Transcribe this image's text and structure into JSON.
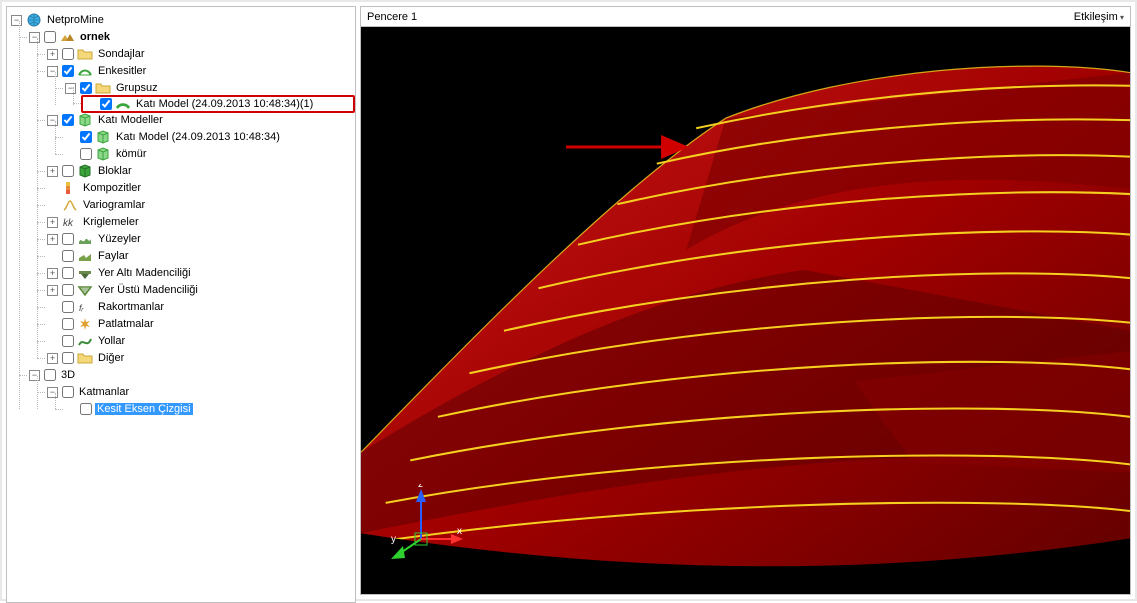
{
  "viewport": {
    "title": "Pencere 1",
    "interaction_label": "Etkileşim",
    "axis": {
      "x": "x",
      "y": "y",
      "z": "z"
    }
  },
  "tree": {
    "root": "NetproMine",
    "project": "ornek",
    "nodes": {
      "sondajlar": "Sondajlar",
      "enkesitler": "Enkesitler",
      "grupsuz": "Grupsuz",
      "katimodel_en": "Katı Model (24.09.2013 10:48:34)(1)",
      "katimodeller": "Katı Modeller",
      "katimodel": "Katı Model (24.09.2013 10:48:34)",
      "komur": "kömür",
      "bloklar": "Bloklar",
      "kompozitler": "Kompozitler",
      "variogramlar": "Variogramlar",
      "kriglemeler": "Kriglemeler",
      "yuzeyler": "Yüzeyler",
      "faylar": "Faylar",
      "yeralti": "Yer Altı Madenciliği",
      "yerustu": "Yer Üstü Madenciliği",
      "rakortmanlar": "Rakortmanlar",
      "patlatmalar": "Patlatmalar",
      "yollar": "Yollar",
      "diger": "Diğer"
    },
    "three_d": "3D",
    "katmanlar": "Katmanlar",
    "kesit_eksen": "Kesit Eksen Çizgisi"
  }
}
